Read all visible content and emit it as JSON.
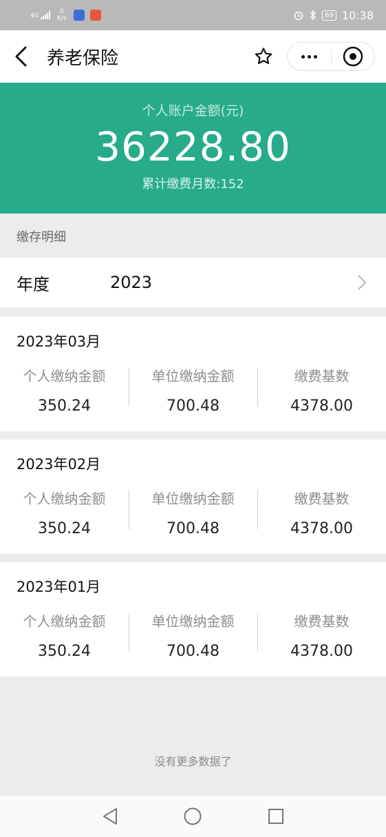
{
  "status_bar": {
    "network": "4G",
    "speed_value": "0",
    "speed_unit": "K/s",
    "battery": "69",
    "time": "10:38"
  },
  "header": {
    "title": "养老保险"
  },
  "summary": {
    "label": "个人账户金额(元)",
    "amount": "36228.80",
    "months_text": "累计缴费月数:152"
  },
  "detail": {
    "section_title": "缴存明细",
    "year_label": "年度",
    "year_value": "2023"
  },
  "columns": {
    "personal": "个人缴纳金额",
    "employer": "单位缴纳金额",
    "base": "缴费基数"
  },
  "records": [
    {
      "month": "2023年03月",
      "personal": "350.24",
      "employer": "700.48",
      "base": "4378.00"
    },
    {
      "month": "2023年02月",
      "personal": "350.24",
      "employer": "700.48",
      "base": "4378.00"
    },
    {
      "month": "2023年01月",
      "personal": "350.24",
      "employer": "700.48",
      "base": "4378.00"
    }
  ],
  "footer": {
    "no_more": "没有更多数据了"
  },
  "colors": {
    "accent": "#27ab8a"
  }
}
